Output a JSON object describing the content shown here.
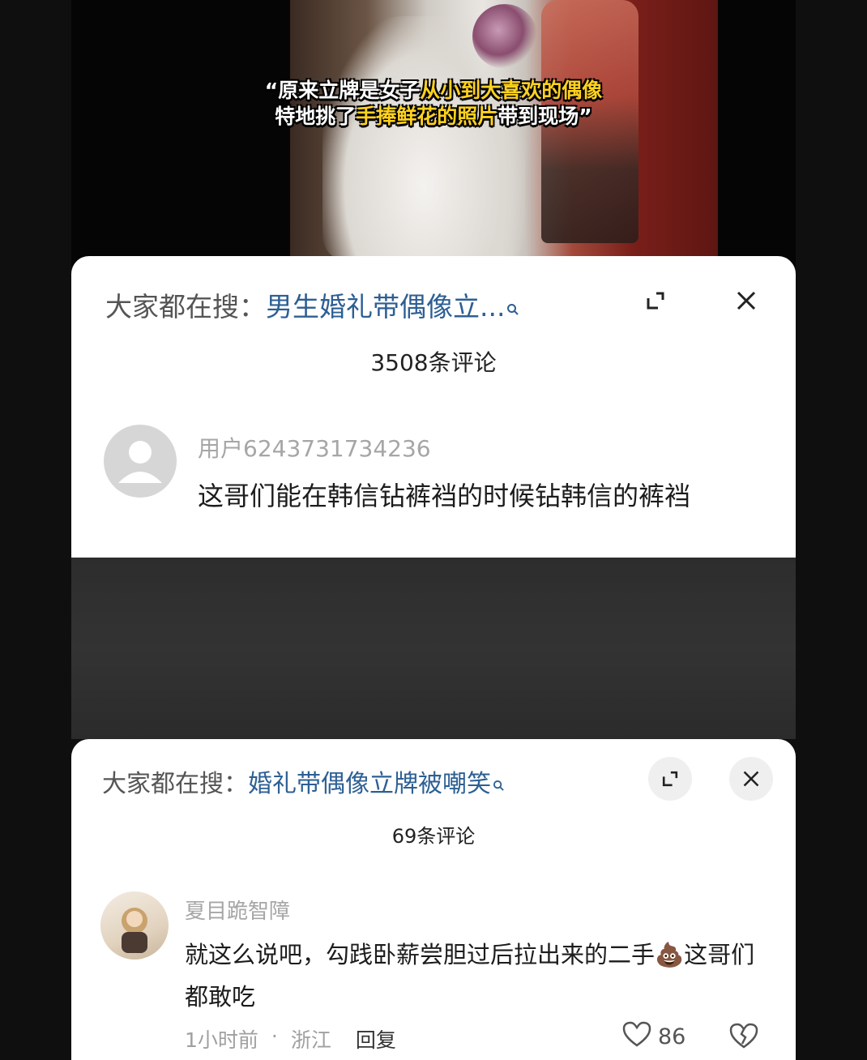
{
  "video": {
    "caption_line1_white": "原来立牌是女子",
    "caption_line1_yellow": "从小到大喜欢的偶像",
    "caption_line2_white_a": "特地挑了",
    "caption_line2_yellow": "手捧鲜花的照片",
    "caption_line2_white_b": "带到现场",
    "quote_open": "“",
    "quote_close": "”"
  },
  "panel1": {
    "search_prefix": "大家都在搜：",
    "search_query": "男生婚礼带偶像立...",
    "comment_count": "3508条评论",
    "comment": {
      "username": "用户6243731734236",
      "text": "这哥们能在韩信钻裤裆的时候钻韩信的裤裆"
    }
  },
  "panel2": {
    "search_prefix": "大家都在搜：",
    "search_query": "婚礼带偶像立牌被嘲笑",
    "comment_count": "69条评论",
    "comment": {
      "username": "夏目跪智障",
      "text": "就这么说吧，勾践卧薪尝胆过后拉出来的二手💩这哥们都敢吃",
      "time": "1小时前",
      "separator": "·",
      "location": "浙江",
      "reply_label": "回复",
      "likes": "86"
    }
  },
  "icons": {
    "search": "search-icon",
    "expand": "expand-icon",
    "close": "close-icon",
    "like": "heart-icon",
    "dislike": "broken-heart-icon"
  }
}
